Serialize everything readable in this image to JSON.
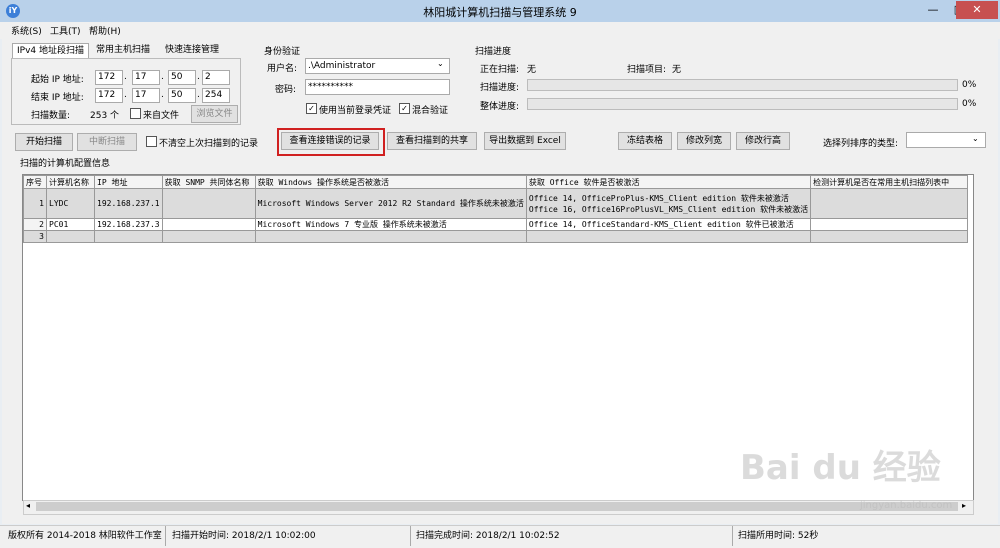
{
  "window": {
    "title": "林阳城计算机扫描与管理系统 9",
    "icon": "app-logo-icon",
    "controls": [
      "—",
      "□",
      "✕"
    ]
  },
  "menu": [
    "系统(S)",
    "工具(T)",
    "帮助(H)"
  ],
  "tabs": [
    "IPv4 地址段扫描",
    "常用主机扫描",
    "快速连接管理"
  ],
  "ipv4": {
    "start_label": "起始 IP 地址:",
    "start_ip": [
      "172",
      "17",
      "50",
      "2"
    ],
    "end_label": "结束 IP 地址:",
    "end_ip": [
      "172",
      "17",
      "50",
      "254"
    ],
    "count_label": "扫描数量:",
    "count_value": "253 个",
    "from_file_label": "来自文件",
    "browse_label": "浏览文件"
  },
  "auth": {
    "title": "身份验证",
    "user_label": "用户名:",
    "user_value": ".\\Administrator",
    "password_label": "密码:",
    "password_value": "**********",
    "use_current_label": "使用当前登录凭证",
    "mixed_label": "混合验证"
  },
  "progress": {
    "title": "扫描进度",
    "scanning_label": "正在扫描:",
    "scanning_value": "无",
    "item_label": "扫描项目:",
    "item_value": "无",
    "scan_progress_label": "扫描进度:",
    "scan_progress_value": "0%",
    "overall_label": "整体进度:",
    "overall_value": "0%"
  },
  "toolbar": {
    "start": "开始扫描",
    "stop": "中断扫描",
    "keep_label": "不清空上次扫描到的记录",
    "view_errors": "查看连接错误的记录",
    "view_shares": "查看扫描到的共享",
    "export": "导出数据到 Excel",
    "freeze": "冻结表格",
    "col_width": "修改列宽",
    "row_height": "修改行高",
    "sort_label": "选择列排序的类型:"
  },
  "table_title": "扫描的计算机配置信息",
  "table": {
    "columns": [
      "序号",
      "计算机名称",
      "IP 地址",
      "获取 SNMP 共同体名称",
      "获取 Windows 操作系统是否被激活",
      "获取 Office 软件是否被激活",
      "检测计算机是否在常用主机扫描列表中"
    ],
    "rows": [
      {
        "no": "1",
        "name": "LYDC",
        "ip": "192.168.237.1",
        "snmp": "",
        "windows": "Microsoft Windows Server 2012 R2 Standard 操作系统未被激活",
        "office": [
          "Office 14, OfficeProPlus-KMS_Client edition 软件未被激活",
          "Office 16, Office16ProPlusVL_KMS_Client edition 软件未被激活"
        ],
        "common": ""
      },
      {
        "no": "2",
        "name": "PC01",
        "ip": "192.168.237.3",
        "snmp": "",
        "windows": "Microsoft Windows 7 专业版 操作系统未被激活",
        "office": [
          "Office 14, OfficeStandard-KMS_Client edition 软件已被激活"
        ],
        "common": ""
      },
      {
        "no": "3",
        "name": "",
        "ip": "",
        "snmp": "",
        "windows": "",
        "office": [
          ""
        ],
        "common": ""
      }
    ]
  },
  "status": {
    "copyright": "版权所有 2014-2018 林阳软件工作室",
    "start_time": "扫描开始时间: 2018/2/1 10:02:00",
    "end_time": "扫描完成时间: 2018/2/1 10:02:52",
    "duration": "扫描所用时间: 52秒"
  },
  "watermark": {
    "text": "Bai du 经验",
    "sub": "jingyan.baidu.com"
  }
}
